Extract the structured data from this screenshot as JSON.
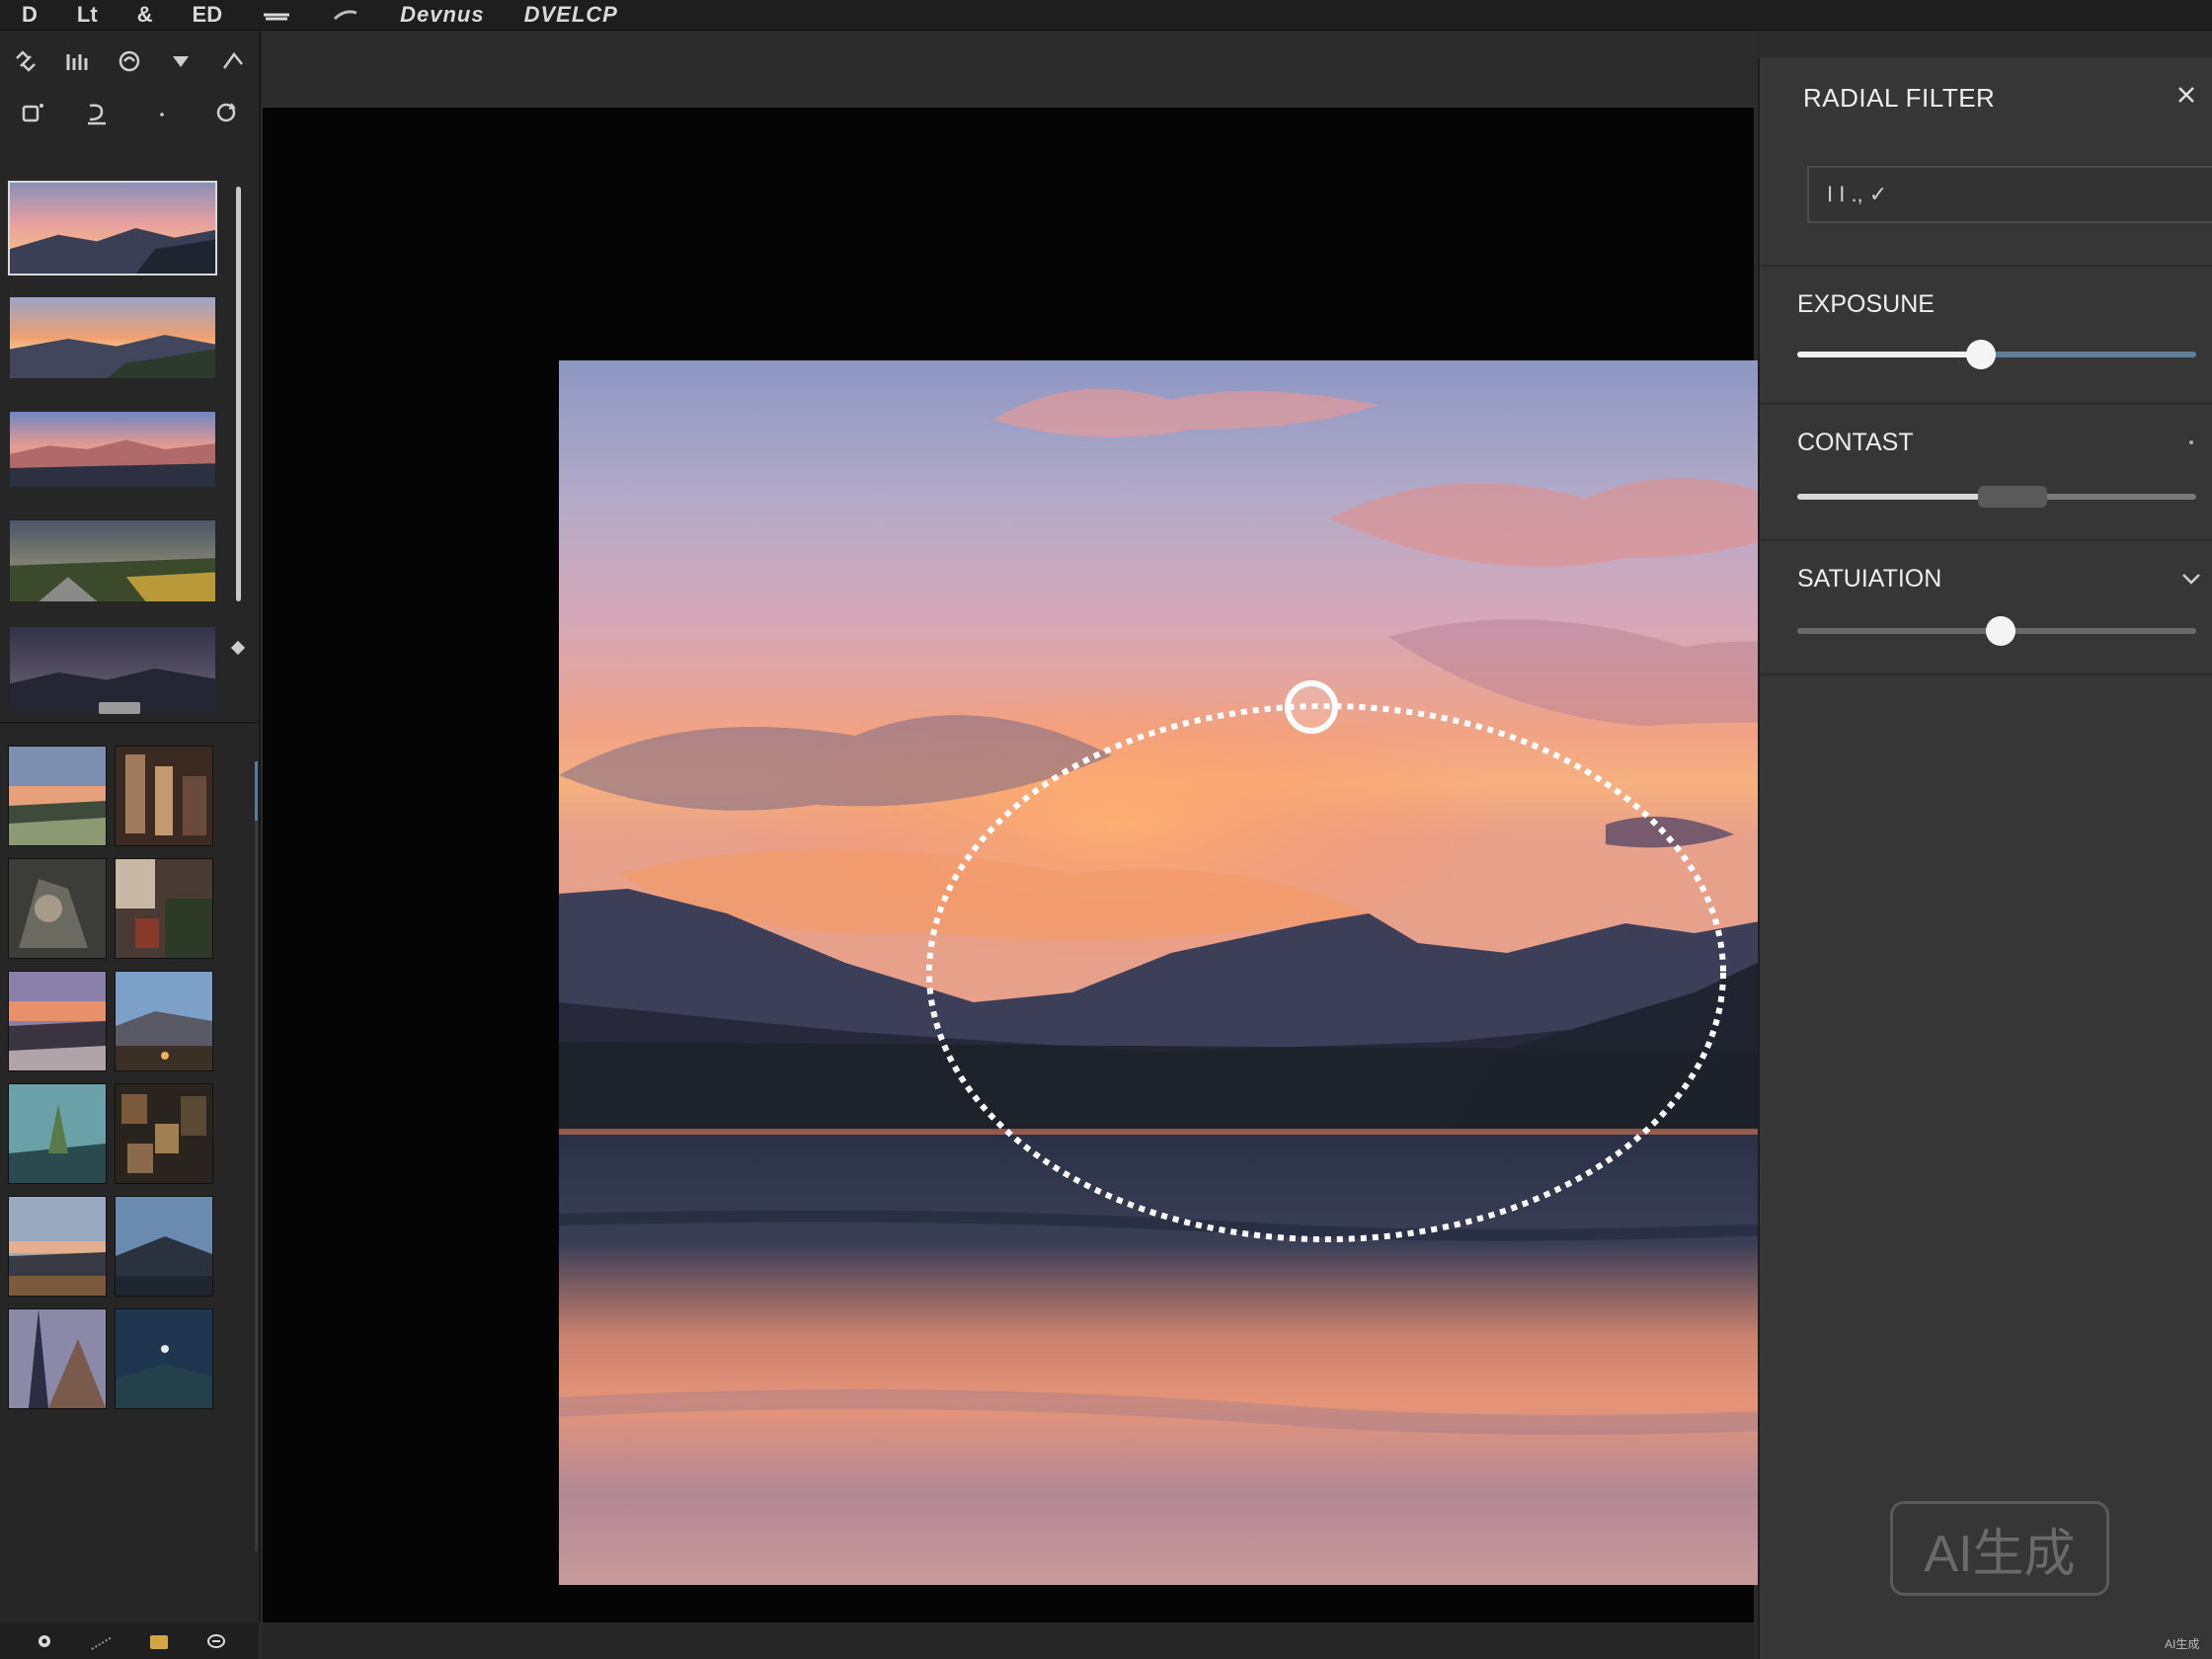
{
  "menubar": {
    "items": [
      "D",
      "Lt",
      "&",
      "ED",
      "",
      "",
      "Devnus",
      "DVELCP"
    ]
  },
  "left_panel": {
    "tools_row1": [
      "link-icon",
      "columns-icon",
      "swirl-icon",
      "triangle-down-icon",
      "pen-icon"
    ],
    "tools_row2": [
      "crop-icon",
      "brush-icon",
      "dot-icon",
      "rotate-icon"
    ],
    "bottom_tools": [
      "color-picker-icon",
      "spray-icon",
      "folder-icon",
      "chat-icon"
    ]
  },
  "right_panel": {
    "title": "RADIAL FILTER",
    "preset_value": "I I ., ✓",
    "sections": [
      {
        "label": "EXPOSUNE",
        "value": 0.46
      },
      {
        "label": "CONTAST",
        "value": 0.54
      },
      {
        "label": "SATUIATION",
        "value": 0.51
      }
    ]
  },
  "watermark": {
    "text": "AI生成",
    "small_text": "AI生成"
  },
  "colors": {
    "accent": "#5e7e9c",
    "panel": "#363636",
    "background": "#2b2b2b"
  }
}
